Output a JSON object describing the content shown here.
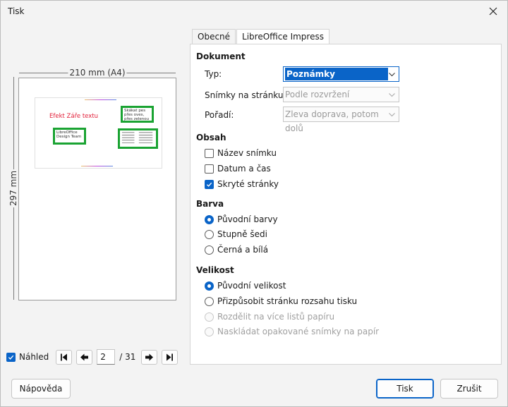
{
  "window": {
    "title": "Tisk"
  },
  "preview": {
    "width_label": "210 mm (A4)",
    "height_label": "297 mm",
    "slide_title": "Efekt Záře textu",
    "box1_text": "Skákat pes přes oves, přes zelenou louku",
    "box2_text": "LibreOffice Design Team",
    "show_preview_label": "Náhled",
    "show_preview_checked": true,
    "current_page": "2",
    "total_pages": "/ 31"
  },
  "tabs": [
    {
      "label": "Obecné",
      "active": false
    },
    {
      "label": "LibreOffice Impress",
      "active": true
    }
  ],
  "document": {
    "heading": "Dokument",
    "type_label": "Typ:",
    "type_value": "Poznámky",
    "slides_per_page_label": "Snímky na stránku:",
    "slides_per_page_value": "Podle rozvržení",
    "order_label": "Pořadí:",
    "order_value": "Zleva doprava, potom dolů"
  },
  "content": {
    "heading": "Obsah",
    "options": [
      {
        "label": "Název snímku",
        "checked": false
      },
      {
        "label": "Datum a čas",
        "checked": false
      },
      {
        "label": "Skryté stránky",
        "checked": true
      }
    ]
  },
  "color": {
    "heading": "Barva",
    "options": [
      {
        "label": "Původní barvy",
        "selected": true
      },
      {
        "label": "Stupně šedi",
        "selected": false
      },
      {
        "label": "Černá a bílá",
        "selected": false
      }
    ]
  },
  "size": {
    "heading": "Velikost",
    "options": [
      {
        "label": "Původní velikost",
        "selected": true,
        "disabled": false
      },
      {
        "label": "Přizpůsobit stránku rozsahu tisku",
        "selected": false,
        "disabled": false
      },
      {
        "label": "Rozdělit na více listů papíru",
        "selected": false,
        "disabled": true
      },
      {
        "label": "Naskládat opakované snímky na papír",
        "selected": false,
        "disabled": true
      }
    ]
  },
  "buttons": {
    "help": "Nápověda",
    "print": "Tisk",
    "cancel": "Zrušit"
  },
  "colors": {
    "accent": "#0a64c8",
    "slide_title": "#e2203a",
    "box_border": "#1aa332"
  }
}
